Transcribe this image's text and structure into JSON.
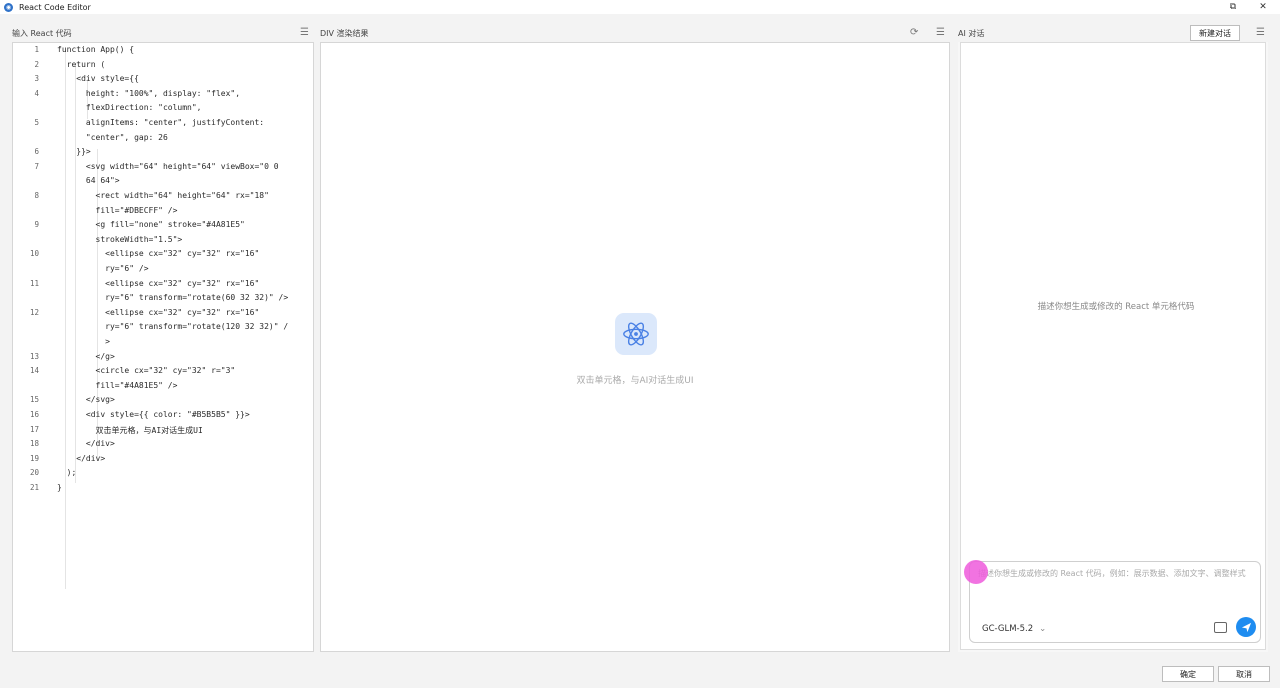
{
  "window": {
    "title": "React Code Editor",
    "restore_symbol": "⧉",
    "close_symbol": "✕"
  },
  "editor": {
    "header": "输入 React 代码",
    "lines": [
      {
        "n": "1",
        "text": "function App() {"
      },
      {
        "n": "2",
        "text": "  return ("
      },
      {
        "n": "3",
        "text": "    <div style={{"
      },
      {
        "n": "4",
        "text": "      height: \"100%\", display: \"flex\","
      },
      {
        "n": "",
        "text": "      flexDirection: \"column\","
      },
      {
        "n": "5",
        "text": "      alignItems: \"center\", justifyContent:"
      },
      {
        "n": "",
        "text": "      \"center\", gap: 26"
      },
      {
        "n": "6",
        "text": "    }}>"
      },
      {
        "n": "7",
        "text": "      <svg width=\"64\" height=\"64\" viewBox=\"0 0"
      },
      {
        "n": "",
        "text": "      64 64\">"
      },
      {
        "n": "8",
        "text": "        <rect width=\"64\" height=\"64\" rx=\"18\""
      },
      {
        "n": "",
        "text": "        fill=\"#DBECFF\" />"
      },
      {
        "n": "9",
        "text": "        <g fill=\"none\" stroke=\"#4A81E5\""
      },
      {
        "n": "",
        "text": "        strokeWidth=\"1.5\">"
      },
      {
        "n": "10",
        "text": "          <ellipse cx=\"32\" cy=\"32\" rx=\"16\""
      },
      {
        "n": "",
        "text": "          ry=\"6\" />"
      },
      {
        "n": "11",
        "text": "          <ellipse cx=\"32\" cy=\"32\" rx=\"16\""
      },
      {
        "n": "",
        "text": "          ry=\"6\" transform=\"rotate(60 32 32)\" />"
      },
      {
        "n": "12",
        "text": "          <ellipse cx=\"32\" cy=\"32\" rx=\"16\""
      },
      {
        "n": "",
        "text": "          ry=\"6\" transform=\"rotate(120 32 32)\" /"
      },
      {
        "n": "",
        "text": "          >"
      },
      {
        "n": "13",
        "text": "        </g>"
      },
      {
        "n": "14",
        "text": "        <circle cx=\"32\" cy=\"32\" r=\"3\""
      },
      {
        "n": "",
        "text": "        fill=\"#4A81E5\" />"
      },
      {
        "n": "15",
        "text": "      </svg>"
      },
      {
        "n": "16",
        "text": "      <div style={{ color: \"#B5B5B5\" }}>"
      },
      {
        "n": "17",
        "text": "        双击单元格，与AI对话生成UI"
      },
      {
        "n": "18",
        "text": "      </div>"
      },
      {
        "n": "19",
        "text": "    </div>"
      },
      {
        "n": "20",
        "text": "  );"
      },
      {
        "n": "21",
        "text": "}"
      }
    ]
  },
  "render": {
    "header": "DIV 渲染结果",
    "hint": "双击单元格，与AI对话生成UI"
  },
  "ai": {
    "header": "AI 对话",
    "new_chat_label": "新建对话",
    "empty_text": "描述你想生成或修改的 React 单元格代码",
    "placeholder": "描述你想生成或修改的 React 代码，例如：展示数据、添加文字、调整样式",
    "model": "GC-GLM-5.2"
  },
  "footer": {
    "ok_label": "确定",
    "cancel_label": "取消"
  },
  "colors": {
    "accent": "#1e8cf0",
    "react_tile": "#DBECFF",
    "react_stroke": "#4A81E5"
  }
}
